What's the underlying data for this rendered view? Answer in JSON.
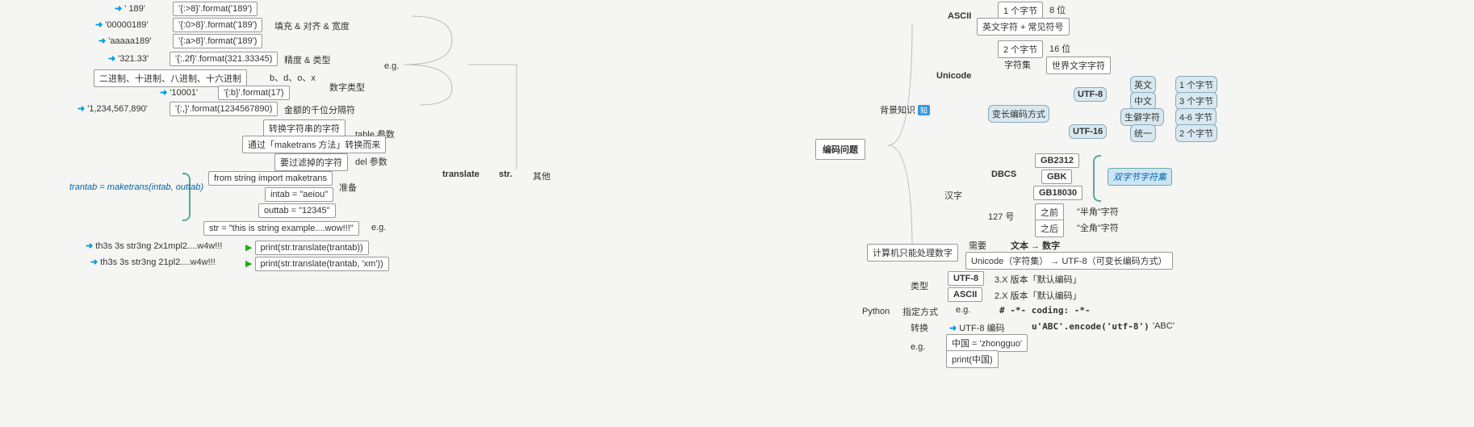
{
  "left": {
    "f1": {
      "r": "'   189'",
      "c": "'{:>8}'.format('189')"
    },
    "f2": {
      "r": "'00000189'",
      "c": "'{:0>8}'.format('189')"
    },
    "f3": {
      "r": "'aaaaa189'",
      "c": "'{:a>8}'.format('189')"
    },
    "f4": {
      "r": "'321.33'",
      "c": "'{:.2f}'.format(321.33345)"
    },
    "f5": {
      "r": "二进制、十进制、八进制、十六进制",
      "c": "b、d、o、x"
    },
    "f6": {
      "r": "'10001'",
      "c": "'{:b}'.format(17)"
    },
    "f7": {
      "r": "'1,234,567,890'",
      "c": "'{:,}'.format(1234567890)"
    },
    "label_fill": "填充 & 对齐 & 宽度",
    "label_prec": "精度 & 类型",
    "label_numtype": "数字类型",
    "label_thou": "金额的千位分隔符",
    "label_eg": "e.g.",
    "t_trans": "转换字符串的字符",
    "t_make": "通过「maketrans 方法」转换而来",
    "t_filter": "要过滤掉的字符",
    "t_table": "table 参数",
    "t_del": "del 参数",
    "prep_import": "from string import maketrans",
    "prep_in": "intab = \"aeiou\"",
    "prep_out": "outtab = \"12345\"",
    "prep_label": "准备",
    "note": "trantab = maketrans(intab, outtab)",
    "ex_str": "str = \"this is string example....wow!!!\"",
    "ex_eg": "e.g.",
    "ex1_r": "th3s 3s str3ng 2x1mpl2....w4w!!!",
    "ex1_c": "print(str.translate(trantab))",
    "ex2_r": "th3s 3s str3ng 21pl2....w4w!!!",
    "ex2_c": "print(str.translate(trantab, 'xm'))",
    "translate": "translate",
    "str": "str.",
    "other": "其他"
  },
  "right": {
    "root": "编码问题",
    "bg": "背景知识",
    "bg_badge": "知",
    "ascii": {
      "title": "ASCII",
      "b1": "1 个字节",
      "b2": "8 位",
      "desc": "英文字符 + 常见符号"
    },
    "uni": {
      "title": "Unicode",
      "b1": "2 个字节",
      "b2": "16 位",
      "charset": "字符集",
      "world": "世界文字字符",
      "varlen": "变长编码方式",
      "utf8": "UTF-8",
      "utf16": "UTF-16",
      "u8_1a": "英文",
      "u8_1b": "1 个字节",
      "u8_2a": "中文",
      "u8_2b": "3 个字节",
      "u8_3a": "生僻字符",
      "u8_3b": "4-6 字节",
      "u16a": "统一",
      "u16b": "2 个字节"
    },
    "han": {
      "title": "汉字",
      "dbcs": "DBCS",
      "gb1": "GB2312",
      "gb2": "GBK",
      "gb3": "GB18030",
      "dbcs_note": "双字节字符集",
      "n127": "127 号",
      "before": "之前",
      "after": "之后",
      "half": "\"半角\"字符",
      "full": "\"全角\"字符"
    },
    "num": {
      "title": "计算机只能处理数字",
      "need": "需要",
      "conv": "文本 → 数字",
      "rule": "Unicode（字符集） → UTF-8（可变长编码方式）"
    },
    "py": {
      "title": "Python",
      "type": "类型",
      "t1": "UTF-8",
      "t1d": "3.X 版本「默认编码」",
      "t2": "ASCII",
      "t2d": "2.X 版本「默认编码」",
      "spec": "指定方式",
      "spec_eg": "e.g.",
      "spec_code": "# -*- coding: -*-",
      "trans": "转换",
      "trans_to": "UTF-8 编码",
      "trans_code": "u'ABC'.encode('utf-8')",
      "trans_res": "'ABC'",
      "eg": "e.g.",
      "eg1": "中国 = 'zhongguo'",
      "eg2": "print(中国)"
    }
  }
}
